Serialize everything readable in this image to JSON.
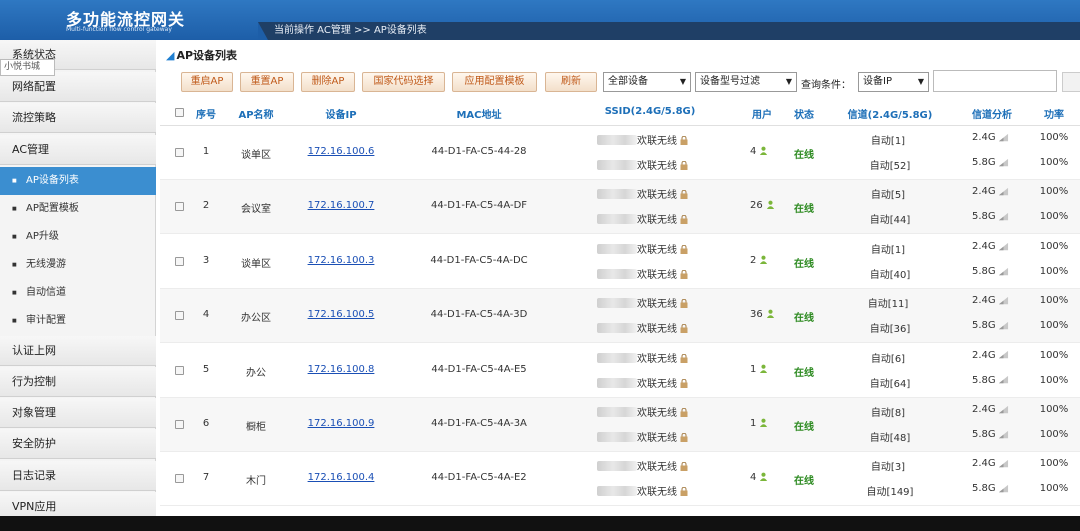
{
  "header": {
    "title": "多功能流控网关",
    "subtitle": "Multi-function flow control gateway",
    "breadcrumb": "当前操作 AC管理 >> AP设备列表"
  },
  "sidebar": {
    "tooltip": "小悦书城",
    "menu": [
      "系统状态",
      "网络配置",
      "流控策略",
      "AC管理"
    ],
    "sub_items": [
      "AP设备列表",
      "AP配置模板",
      "AP升级",
      "无线漫游",
      "自动信道",
      "审计配置"
    ],
    "menu_after": [
      "认证上网",
      "行为控制",
      "对象管理",
      "安全防护",
      "日志记录",
      "VPN应用"
    ]
  },
  "page": {
    "title": "AP设备列表",
    "buttons": [
      "重启AP",
      "重置AP",
      "删除AP",
      "国家代码选择",
      "应用配置模板",
      "刷新"
    ],
    "filter_device": "全部设备",
    "filter_model": "设备型号过滤",
    "query_label": "查询条件：",
    "query_field": "设备IP",
    "query_value": ""
  },
  "table": {
    "headers": [
      "序号",
      "AP名称",
      "设备IP",
      "MAC地址",
      "SSID(2.4G/5.8G)",
      "用户",
      "状态",
      "信道(2.4G/5.8G)",
      "信道分析",
      "功率"
    ],
    "ssid_suffix": "欢联无线",
    "band_24": "2.4G",
    "band_58": "5.8G",
    "rows": [
      {
        "no": "1",
        "name": "谈单区",
        "ip": "172.16.100.6",
        "mac": "44-D1-FA-C5-44-28",
        "users": "4",
        "status": "在线",
        "ch24": "自动[1]",
        "ch58": "自动[52]",
        "p24": "100%",
        "p58": "100%"
      },
      {
        "no": "2",
        "name": "会议室",
        "ip": "172.16.100.7",
        "mac": "44-D1-FA-C5-4A-DF",
        "users": "26",
        "status": "在线",
        "ch24": "自动[5]",
        "ch58": "自动[44]",
        "p24": "100%",
        "p58": "100%"
      },
      {
        "no": "3",
        "name": "谈单区",
        "ip": "172.16.100.3",
        "mac": "44-D1-FA-C5-4A-DC",
        "users": "2",
        "status": "在线",
        "ch24": "自动[1]",
        "ch58": "自动[40]",
        "p24": "100%",
        "p58": "100%"
      },
      {
        "no": "4",
        "name": "办公区",
        "ip": "172.16.100.5",
        "mac": "44-D1-FA-C5-4A-3D",
        "users": "36",
        "status": "在线",
        "ch24": "自动[11]",
        "ch58": "自动[36]",
        "p24": "100%",
        "p58": "100%"
      },
      {
        "no": "5",
        "name": "办公",
        "ip": "172.16.100.8",
        "mac": "44-D1-FA-C5-4A-E5",
        "users": "1",
        "status": "在线",
        "ch24": "自动[6]",
        "ch58": "自动[64]",
        "p24": "100%",
        "p58": "100%"
      },
      {
        "no": "6",
        "name": "橱柜",
        "ip": "172.16.100.9",
        "mac": "44-D1-FA-C5-4A-3A",
        "users": "1",
        "status": "在线",
        "ch24": "自动[8]",
        "ch58": "自动[48]",
        "p24": "100%",
        "p58": "100%"
      },
      {
        "no": "7",
        "name": "木门",
        "ip": "172.16.100.4",
        "mac": "44-D1-FA-C5-4A-E2",
        "users": "4",
        "status": "在线",
        "ch24": "自动[3]",
        "ch58": "自动[149]",
        "p24": "100%",
        "p58": "100%"
      }
    ]
  },
  "colors": {
    "header": "#2f78c2",
    "accent": "#3b8ed0",
    "online": "#2e8b22",
    "link": "#1a4fb5",
    "button_text": "#c05a1a"
  },
  "icons": {
    "user": "user-icon",
    "lock": "lock-icon",
    "wifi": "wifi-signal-icon"
  }
}
